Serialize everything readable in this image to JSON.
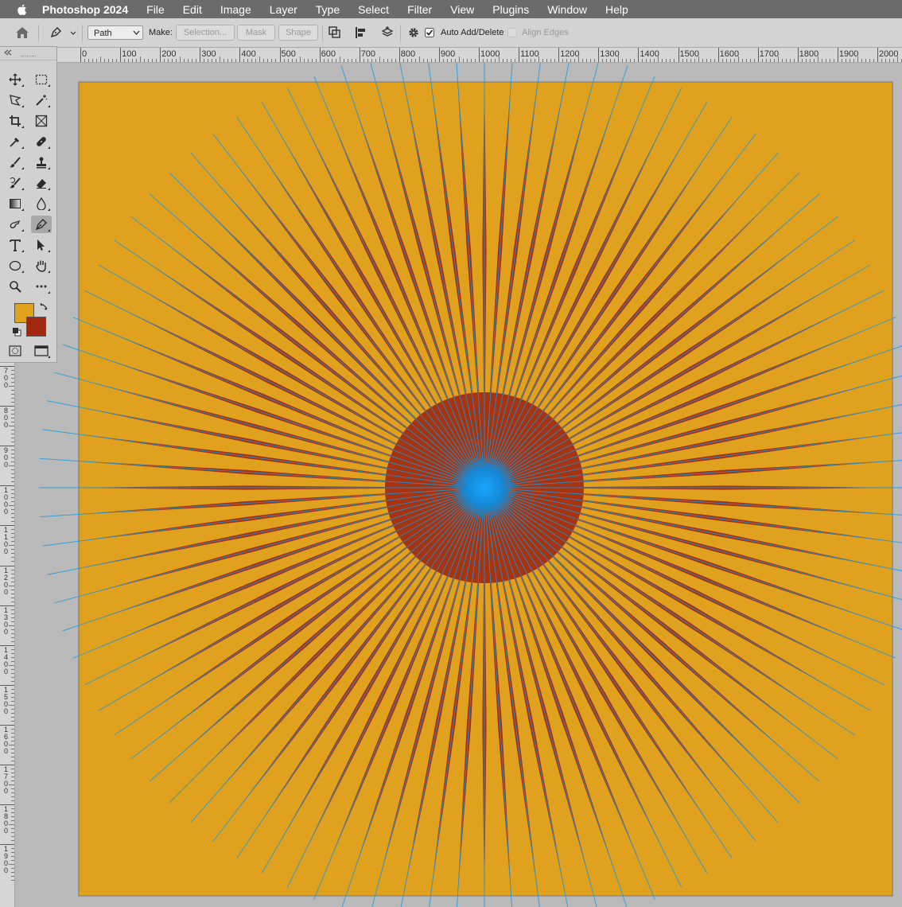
{
  "menubar": {
    "app_name": "Photoshop 2024",
    "items": [
      "File",
      "Edit",
      "Image",
      "Layer",
      "Type",
      "Select",
      "Filter",
      "View",
      "Plugins",
      "Window",
      "Help"
    ]
  },
  "options_bar": {
    "tool_mode_value": "Path",
    "make_label": "Make:",
    "selection_button": "Selection...",
    "mask_button": "Mask",
    "shape_button": "Shape",
    "auto_add_delete_label": "Auto Add/Delete",
    "auto_add_delete_checked": true,
    "align_edges_label": "Align Edges",
    "align_edges_checked": false
  },
  "ruler": {
    "horizontal_labels": [
      "0",
      "100",
      "200",
      "300",
      "400",
      "500",
      "600",
      "700",
      "800",
      "900",
      "1000",
      "1100",
      "1200",
      "1300",
      "1400",
      "1500",
      "1600",
      "1700",
      "1800",
      "1900",
      "2000"
    ],
    "vertical_labels": [
      "700",
      "800",
      "900",
      "1000",
      "1100",
      "1200",
      "1300",
      "1400",
      "1500",
      "1600",
      "1700",
      "1800",
      "1900"
    ]
  },
  "tools": {
    "active": "pen-tool",
    "items": [
      "move-tool",
      "marquee-tool",
      "lasso-tool",
      "magic-wand-tool",
      "crop-tool",
      "frame-tool",
      "eyedropper-tool",
      "healing-brush-tool",
      "brush-tool",
      "clone-stamp-tool",
      "history-brush-tool",
      "eraser-tool",
      "gradient-tool",
      "blur-tool",
      "smudge-tool",
      "pen-tool",
      "type-tool",
      "path-selection-tool",
      "ellipse-tool",
      "hand-tool",
      "zoom-tool",
      "more-tools"
    ]
  },
  "colors": {
    "foreground": "#e0a21e",
    "background": "#a1280e",
    "canvas_fill": "#e0a21e",
    "ray_color": "#a1280e",
    "path_color": "#1a9be0",
    "center_glow": "#1a8fe6"
  }
}
